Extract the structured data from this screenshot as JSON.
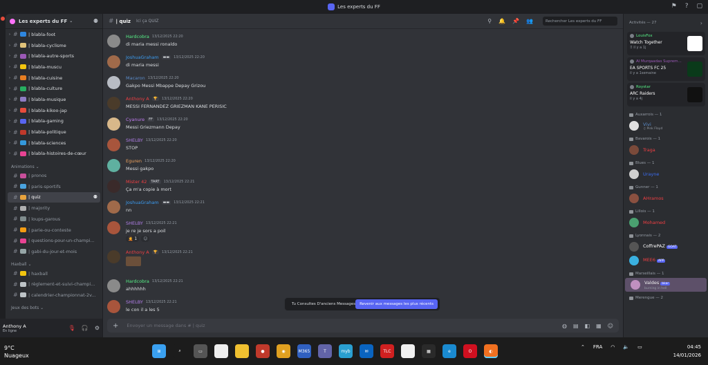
{
  "window": {
    "title": "Les experts du FF"
  },
  "server": {
    "name": "Les experts du FF"
  },
  "channels_top": [
    {
      "label": "| blabla-foot",
      "color": "#2e86de"
    },
    {
      "label": "| blabla-cyclisme",
      "color": "#e0c27a"
    },
    {
      "label": "| blabla-autre-sports",
      "color": "#9b59b6"
    },
    {
      "label": "| blabla-muscu",
      "color": "#f1c40f"
    },
    {
      "label": "| blabla-cuisine",
      "color": "#e67e22"
    },
    {
      "label": "| blabla-culture",
      "color": "#27ae60"
    },
    {
      "label": "| blabla-musique",
      "color": "#8e7cc3"
    },
    {
      "label": "| blabla-kikoo-jap",
      "color": "#e74c3c"
    },
    {
      "label": "| blabla-gaming",
      "color": "#5865f2"
    },
    {
      "label": "| blabla-politique",
      "color": "#c0392b"
    },
    {
      "label": "| blabla-sciences",
      "color": "#3498db"
    },
    {
      "label": "| blabla-histoires-de-cœur",
      "color": "#e84393"
    }
  ],
  "categories": {
    "animations": "Animations",
    "haxball": "Haxball",
    "bots": "Jeux des bots"
  },
  "channels_animations": [
    {
      "label": "| pronos",
      "color": "#c94f9b"
    },
    {
      "label": "| paris-sportifs",
      "color": "#4aa3df"
    },
    {
      "label": "| quiz",
      "color": "#e8a33d",
      "active": true
    },
    {
      "label": "| majority",
      "color": "#b0b0b0"
    },
    {
      "label": "| loups-garous",
      "color": "#7f8c8d"
    },
    {
      "label": "| parie-ou-conteste",
      "color": "#f39c12"
    },
    {
      "label": "| questions-pour-un-champi...",
      "color": "#e84393"
    },
    {
      "label": "| gabi-du-jour-et-mois",
      "color": "#95a5a6"
    }
  ],
  "channels_haxball": [
    {
      "label": "| haxball",
      "color": "#f1c40f"
    },
    {
      "label": "| règlement-et-suivi-champi...",
      "color": "#bdc3c7"
    },
    {
      "label": "| calendrier-championnat-2v...",
      "color": "#bdc3c7"
    }
  ],
  "user": {
    "name": "Anthony A",
    "status": "En ligne"
  },
  "chat": {
    "channel": "| quiz",
    "topic": "Ici ça QUIZ",
    "search_placeholder": "Rechercher Les experts du FF",
    "composer_placeholder": "Envoyer un message dans # | quiz",
    "jump_text": "Tu Consultes D'anciens Messages",
    "jump_button": "Revenir aux messages les plus récents"
  },
  "messages": [
    {
      "author": "Hardcobra",
      "color": "#57f287",
      "time": "13/12/2025 22:20",
      "text": "di maria messi ronaldo",
      "avatar": "#8a8a8a"
    },
    {
      "author": "JoshuaGraham",
      "color": "#3b9df2",
      "time": "13/12/2025 22:20",
      "text": "di maria messi",
      "avatar": "#a06a4a",
      "badge": "▬▬"
    },
    {
      "author": "Macaron",
      "color": "#5b8cc9",
      "time": "13/12/2025 22:20",
      "text": "Gakpo Messi Mbappe Depay Grizou",
      "avatar": "#b8bcc4"
    },
    {
      "author": "Anthony A",
      "color": "#f23f43",
      "time": "13/12/2025 22:20",
      "text": "MESSI FERNANDEZ GRIEZMAN KANE PERISIC",
      "avatar": "#4a3b2a",
      "badge": "🏆"
    },
    {
      "author": "Cyanure",
      "color": "#c27cf2",
      "time": "13/12/2025 22:20",
      "text": "Messi Griezmann Depay",
      "avatar": "#d8b88a",
      "badge": "FF"
    },
    {
      "author": "SHELBY",
      "color": "#b37feb",
      "time": "13/12/2025 22:20",
      "text": "STOP",
      "avatar": "#a8553c"
    },
    {
      "author": "Eguren",
      "color": "#f0a35e",
      "time": "13/12/2025 22:20",
      "text": "Messi gakpo",
      "avatar": "#5fb0a0"
    },
    {
      "author": "Mister 42",
      "color": "#f23f43",
      "time": "13/12/2025 22:21",
      "text": "Ça m'a copie à mort",
      "avatar": "#3a2a2a",
      "badge": "TART"
    },
    {
      "author": "JoshuaGraham",
      "color": "#3b9df2",
      "time": "13/12/2025 22:21",
      "text": "nn",
      "avatar": "#a06a4a",
      "badge": "▬▬"
    },
    {
      "author": "SHELBY",
      "color": "#b37feb",
      "time": "13/12/2025 22:21",
      "text": "je re je sors a poil",
      "avatar": "#a8553c",
      "reactions": [
        {
          "label": "🤦 1"
        },
        {
          "label": "☺"
        }
      ]
    },
    {
      "author": "Anthony A",
      "color": "#f23f43",
      "time": "13/12/2025 22:21",
      "text": "",
      "avatar": "#4a3b2a",
      "badge": "🏆",
      "gif": true
    },
    {
      "author": "Hardcobra",
      "color": "#57f287",
      "time": "13/12/2025 22:21",
      "text": "ahhhhhh",
      "avatar": "#8a8a8a"
    },
    {
      "author": "SHELBY",
      "color": "#b37feb",
      "time": "13/12/2025 22:21",
      "text": "le con il a les 5",
      "avatar": "#a8553c"
    }
  ],
  "activity": {
    "header": "Activités — 27",
    "cards": [
      {
        "user": "LouisFox",
        "ucolor": "#57f287",
        "game": "Watch Together",
        "sub": "⠿ il y a 1j",
        "thumb": "#ffffff"
      },
      {
        "user": "Al Murqaadas Suprem...",
        "ucolor": "#9b59b6",
        "game": "EA SPORTS FC 25",
        "sub": "il y a 1semaine",
        "thumb": "#0a3a1a"
      },
      {
        "user": "Roystar",
        "ucolor": "#57f287",
        "game": "ARC Raiders",
        "sub": "il y a 4j",
        "thumb": "#111111"
      }
    ]
  },
  "member_groups": [
    {
      "role": "Auxarrois — 1",
      "members": [
        {
          "name": "Vivi",
          "color": "#5b8cc9",
          "status": "♫ Pink Floyd",
          "avatar": "#e0e0e0"
        }
      ]
    },
    {
      "role": "Bavarois — 1",
      "members": [
        {
          "name": "Traga",
          "color": "#f23f43",
          "status": "",
          "avatar": "#7a4a3a"
        }
      ]
    },
    {
      "role": "Blues — 1",
      "members": [
        {
          "name": "Urayne",
          "color": "#3b6df2",
          "status": "",
          "avatar": "#d0d0d0"
        }
      ]
    },
    {
      "role": "Gunner — 1",
      "members": [
        {
          "name": "AHramos",
          "color": "#f23f43",
          "status": "",
          "avatar": "#8a5040"
        }
      ]
    },
    {
      "role": "Lillois — 1",
      "members": [
        {
          "name": "Mohamed",
          "color": "#f23f43",
          "status": "",
          "avatar": "#4aa070"
        }
      ]
    },
    {
      "role": "Lyonnais — 2",
      "members": [
        {
          "name": "CoffrePAZ",
          "color": "#ffffff",
          "status": "",
          "avatar": "#555555",
          "tag": "GOAT"
        },
        {
          "name": "MEE6",
          "color": "#f23f43",
          "status": "",
          "avatar": "#3ab0e0",
          "tag": "APP"
        }
      ]
    },
    {
      "role": "Marseillais — 1",
      "members": [
        {
          "name": "Valdes",
          "color": "#f0f0f0",
          "status": "burning in hell",
          "avatar": "#c090c0",
          "tag": "bkar",
          "hl": true
        }
      ]
    },
    {
      "role": "Merengue — 2",
      "members": []
    }
  ],
  "taskbar": {
    "temp": "9°C",
    "weather": "Nuageux",
    "lang": "FRA",
    "time": "04:45",
    "date": "14/01/2026",
    "apps": [
      {
        "name": "start-button",
        "color": "#3aa0f0",
        "glyph": "⊞"
      },
      {
        "name": "search-app",
        "color": "#1c1c1c",
        "glyph": "⌕"
      },
      {
        "name": "taskview-app",
        "color": "#555",
        "glyph": "▭"
      },
      {
        "name": "file-app",
        "color": "#eeeeee",
        "glyph": ""
      },
      {
        "name": "explorer-app",
        "color": "#f0c030",
        "glyph": ""
      },
      {
        "name": "record-app",
        "color": "#c0392b",
        "glyph": "●"
      },
      {
        "name": "chrome-app",
        "color": "#e0a020",
        "glyph": "◉"
      },
      {
        "name": "m365-app",
        "color": "#3060c0",
        "glyph": "M365"
      },
      {
        "name": "teams-app",
        "color": "#6264a7",
        "glyph": "T"
      },
      {
        "name": "myb-app",
        "color": "#2a9fd0",
        "glyph": "myb"
      },
      {
        "name": "mail-app",
        "color": "#0a64c0",
        "glyph": "✉"
      },
      {
        "name": "tlc-app",
        "color": "#d02020",
        "glyph": "TLC"
      },
      {
        "name": "notes-app",
        "color": "#f0f0f0",
        "glyph": ""
      },
      {
        "name": "store-app",
        "color": "#2a2a2a",
        "glyph": "▦"
      },
      {
        "name": "edge-app",
        "color": "#1a8ad0",
        "glyph": "e"
      },
      {
        "name": "opera-app",
        "color": "#d01020",
        "glyph": "O"
      },
      {
        "name": "firefox-app",
        "color": "#f07020",
        "glyph": "◐",
        "active": true
      }
    ]
  }
}
